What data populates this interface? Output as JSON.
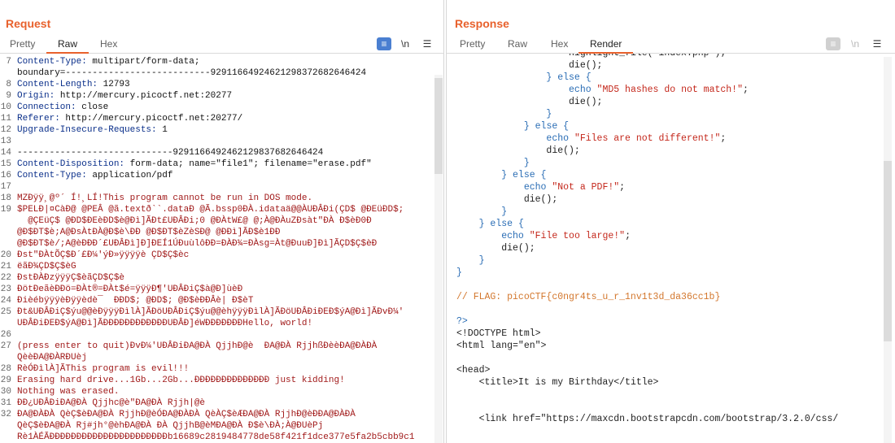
{
  "layout_buttons": [
    {
      "name": "split-horizontal",
      "active": true
    },
    {
      "name": "split-vertical",
      "active": false
    },
    {
      "name": "single-pane",
      "active": false
    }
  ],
  "request": {
    "title": "Request",
    "tabs": [
      "Pretty",
      "Raw",
      "Hex"
    ],
    "active_tab": "Raw",
    "icons": {
      "wrap": "≡",
      "newline": "\\n",
      "menu": "☰"
    },
    "lines": [
      {
        "n": "7",
        "k": "Content-Type:",
        "v": " multipart/form-data;"
      },
      {
        "n": "",
        "k": "",
        "v": "boundary=---------------------------9291166492462129837268264642​4"
      },
      {
        "n": "8",
        "k": "Content-Length:",
        "v": " 12793"
      },
      {
        "n": "9",
        "k": "Origin:",
        "v": " http://mercury.picoctf.net:20277"
      },
      {
        "n": "10",
        "k": "Connection:",
        "v": " close"
      },
      {
        "n": "11",
        "k": "Referer:",
        "v": " http://mercury.picoctf.net:20277/"
      },
      {
        "n": "12",
        "k": "Upgrade-Insecure-Requests:",
        "v": " 1"
      },
      {
        "n": "13",
        "k": "",
        "v": ""
      },
      {
        "n": "14",
        "k": "",
        "v": "-----------------------------92911664924621298376826464​24"
      },
      {
        "n": "15",
        "k": "Content-Disposition:",
        "v": " form-data; name=\"file1\"; filename=\"erase.pdf\""
      },
      {
        "n": "16",
        "k": "Content-Type:",
        "v": " application/pdf"
      },
      {
        "n": "17",
        "k": "",
        "v": ""
      },
      {
        "n": "18",
        "k": "",
        "v": "MZÐÿÿ¸@º´ Í!¸LÍ!This program cannot be run in DOS mode.",
        "bin": true
      },
      {
        "n": "19",
        "k": "",
        "v": "$PELÐ|¤CàÐ@ @PEÂ @ã.textð``.dataÐ @Ã.bssp0ÐÀ.idataä@@ÀUÐÂÐi(ÇD$ @ÐEüÐD$;",
        "bin": true
      },
      {
        "n": "",
        "k": "",
        "v": "  @ÇEüÇ$ @ÐD$ÐEèÐD$è@Ðì]ÃÐt£UÐÂÐi;0 @ÐÀtW£@ @;À@ÐÀuZÐsàt\"ÐÀ Ð$èÐ0Ð",
        "bin": true
      },
      {
        "n": "",
        "k": "",
        "v": "@Ð$ÐT$è;A@ÐsÀtÐÀ@Ð$è\\ÐÐ @Ð$ÐT$èZèSÐ@ @ÐÐì]ÃÐ$è1ÐÐ",
        "bin": true
      },
      {
        "n": "",
        "k": "",
        "v": "@Ð$ÐT$è/;A@èÐÐÐ´£UÐÂÐì]Ð]ÐEÍ1ÚÐuùlôÐÐ=ÐÀÐ¾=ÐÀsg=Àt@ÐuuÐ]Ðì]ÃÇD$Ç$èÐ",
        "bin": true
      },
      {
        "n": "20",
        "k": "",
        "v": "Ðst\"ÐÀtÕÇ$Ð´£Ð¼'ýÐ»ÿÿÿÿè ÇD$Ç$èc",
        "bin": true
      },
      {
        "n": "21",
        "k": "",
        "v": "ëãÐ¾ÇD$Ç$èG",
        "bin": true
      },
      {
        "n": "22",
        "k": "",
        "v": "ÐstÐÀÐzÿÿÿÇ$èãÇD$Ç$è",
        "bin": true
      },
      {
        "n": "23",
        "k": "",
        "v": "ÐötÐeãèÐÐö=ÐÀt®=ÐÀt$é=ÿÿÿÐ¶'UÐÂÐiÇ$à@Ð]ùèÐ",
        "bin": true
      },
      {
        "n": "24",
        "k": "",
        "v": "ÐièébÿÿÿèÐÿÿèdè¯  ÐÐD$; @ÐD$; @Ð$èÐÐÂè| Ð$èT",
        "bin": true
      },
      {
        "n": "25",
        "k": "",
        "v": "Ðt&UÐÂÐiÇ$ýu@@èÐÿÿÿÐìlÀ]ÃÐöUÐÂÐiÇ$ýu@@èhÿÿÿÐìlÀ]ÃÐöUÐÂÐiÐEÐ$ýA@Ðì]ÃÐvÐ¼'",
        "bin": true
      },
      {
        "n": "",
        "k": "",
        "v": "UÐÂÐiÐEÐ$ýA@Ðì]ÃÐÐÐÐÐÐÐÐÐÐÐÐUÐÂÐ]éWÐÐÐÐÐÐÐHello, world!",
        "bin": true
      },
      {
        "n": "26",
        "k": "",
        "v": "",
        "bin": true
      },
      {
        "n": "27",
        "k": "",
        "v": "(press enter to quit)ÐvÐ¼'UÐÂÐiÐA@ÐÀ QjjhÐ@è  ÐA@ÐÀ RjjhßÐèèÐA@ÐÀÐÀ",
        "bin": true
      },
      {
        "n": "",
        "k": "",
        "v": "QèèÐA@ÐÀRÐUèj",
        "bin": true
      },
      {
        "n": "28",
        "k": "",
        "v": "RèÓÐìlÀ]ÃThis program is evil!!!",
        "bin": true
      },
      {
        "n": "29",
        "k": "",
        "v": "Erasing hard drive...1Gb...2Gb...ÐÐÐÐÐÐÐÐÐÐÐÐÐÐ just kidding!",
        "bin": true
      },
      {
        "n": "30",
        "k": "",
        "v": "Nothing was erased.",
        "bin": true
      },
      {
        "n": "31",
        "k": "",
        "v": "ÐÐ¿UÐÂÐiÐA@ÐÀ Qjjhc@è\"ÐA@ÐÀ Rjjh|@è",
        "bin": true
      },
      {
        "n": "32",
        "k": "",
        "v": "ÐA@ÐÀÐÀ QèÇ$èÐA@ÐÀ RjjhÐ@èÓÐA@ÐÀÐÀ QèÀÇ$èÆÐA@ÐÀ RjjhÐ@èÐÐA@ÐÀÐÀ",
        "bin": true
      },
      {
        "n": "",
        "k": "",
        "v": "QèÇ$èÐA@ÐÀ Rj#jh°@èhÐA@ÐÀ ÐÀ QjjhB@èMÐA@ÐÀ Ð$è\\ÐÀ;À@ÐUèPj",
        "bin": true
      },
      {
        "n": "",
        "k": "",
        "v": "Rè1ÀÉÃÐÐÐÐÐÐÐÐÐÐÐÐÐÐÐÐÐÐÐÐÐÐb16689c2819484778de58f421f1dce377e5fa2b5cbb9c1",
        "bin": true
      }
    ]
  },
  "response": {
    "title": "Response",
    "tabs": [
      "Pretty",
      "Raw",
      "Hex",
      "Render"
    ],
    "active_tab": "Render",
    "icons": {
      "wrap": "≡",
      "newline": "\\n",
      "menu": "☰"
    },
    "lines": [
      {
        "indent": "                    ",
        "parts": [
          [
            "plain",
            "highlight_file('index.php');"
          ]
        ]
      },
      {
        "indent": "                    ",
        "parts": [
          [
            "plain",
            "die();"
          ]
        ]
      },
      {
        "indent": "                ",
        "parts": [
          [
            "brace",
            "}"
          ],
          [
            "kw",
            " else "
          ],
          [
            "brace",
            "{"
          ]
        ]
      },
      {
        "indent": "                    ",
        "parts": [
          [
            "kw",
            "echo "
          ],
          [
            "str",
            "\"MD5 hashes do not match!\""
          ],
          [
            "plain",
            ";"
          ]
        ]
      },
      {
        "indent": "                    ",
        "parts": [
          [
            "plain",
            "die();"
          ]
        ]
      },
      {
        "indent": "                ",
        "parts": [
          [
            "brace",
            "}"
          ]
        ]
      },
      {
        "indent": "            ",
        "parts": [
          [
            "brace",
            "}"
          ],
          [
            "kw",
            " else "
          ],
          [
            "brace",
            "{"
          ]
        ]
      },
      {
        "indent": "                ",
        "parts": [
          [
            "kw",
            "echo "
          ],
          [
            "str",
            "\"Files are not different!\""
          ],
          [
            "plain",
            ";"
          ]
        ]
      },
      {
        "indent": "                ",
        "parts": [
          [
            "plain",
            "die();"
          ]
        ]
      },
      {
        "indent": "            ",
        "parts": [
          [
            "brace",
            "}"
          ]
        ]
      },
      {
        "indent": "        ",
        "parts": [
          [
            "brace",
            "}"
          ],
          [
            "kw",
            " else "
          ],
          [
            "brace",
            "{"
          ]
        ]
      },
      {
        "indent": "            ",
        "parts": [
          [
            "kw",
            "echo "
          ],
          [
            "str",
            "\"Not a PDF!\""
          ],
          [
            "plain",
            ";"
          ]
        ]
      },
      {
        "indent": "            ",
        "parts": [
          [
            "plain",
            "die();"
          ]
        ]
      },
      {
        "indent": "        ",
        "parts": [
          [
            "brace",
            "}"
          ]
        ]
      },
      {
        "indent": "    ",
        "parts": [
          [
            "brace",
            "}"
          ],
          [
            "kw",
            " else "
          ],
          [
            "brace",
            "{"
          ]
        ]
      },
      {
        "indent": "        ",
        "parts": [
          [
            "kw",
            "echo "
          ],
          [
            "str",
            "\"File too large!\""
          ],
          [
            "plain",
            ";"
          ]
        ]
      },
      {
        "indent": "        ",
        "parts": [
          [
            "plain",
            "die();"
          ]
        ]
      },
      {
        "indent": "    ",
        "parts": [
          [
            "brace",
            "}"
          ]
        ]
      },
      {
        "indent": "",
        "parts": [
          [
            "brace",
            "}"
          ]
        ]
      },
      {
        "indent": "",
        "parts": []
      },
      {
        "indent": "",
        "parts": [
          [
            "cmt",
            "// FLAG: picoCTF{c0ngr4ts_u_r_1nv1t3d_da36cc1b}"
          ]
        ]
      },
      {
        "indent": "",
        "parts": []
      },
      {
        "indent": "",
        "parts": [
          [
            "brace",
            "?>"
          ]
        ]
      },
      {
        "indent": "",
        "parts": [
          [
            "plain",
            "<!DOCTYPE html>"
          ]
        ]
      },
      {
        "indent": "",
        "parts": [
          [
            "plain",
            "<html lang=\"en\">"
          ]
        ]
      },
      {
        "indent": "",
        "parts": []
      },
      {
        "indent": "",
        "parts": [
          [
            "plain",
            "<head>"
          ]
        ]
      },
      {
        "indent": "    ",
        "parts": [
          [
            "plain",
            "<title>It is my Birthday</title>"
          ]
        ]
      },
      {
        "indent": "",
        "parts": []
      },
      {
        "indent": "",
        "parts": []
      },
      {
        "indent": "    ",
        "parts": [
          [
            "plain",
            "<link href=\"https://maxcdn.bootstrapcdn.com/bootstrap/3.2.0/css/"
          ]
        ]
      },
      {
        "indent": "",
        "parts": []
      }
    ]
  }
}
